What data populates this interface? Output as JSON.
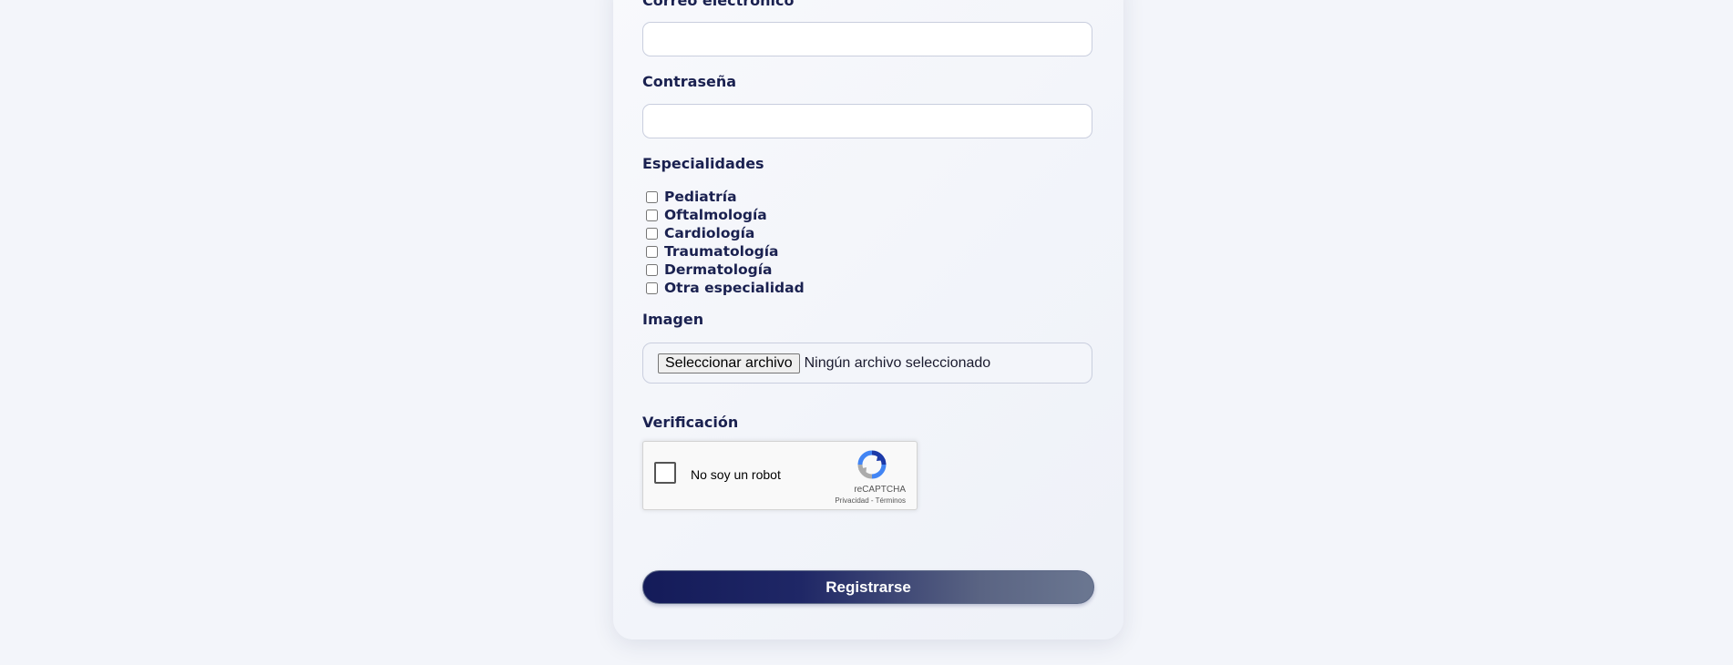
{
  "form": {
    "email_label": "Correo electrónico",
    "email_value": "",
    "password_label": "Contraseña",
    "password_value": "",
    "specialties_label": "Especialidades",
    "specialties": [
      {
        "label": "Pediatría",
        "checked": false
      },
      {
        "label": "Oftalmología",
        "checked": false
      },
      {
        "label": "Cardiología",
        "checked": false
      },
      {
        "label": "Traumatología",
        "checked": false
      },
      {
        "label": "Dermatología",
        "checked": false
      },
      {
        "label": "Otra especialidad",
        "checked": false
      }
    ],
    "image_label": "Imagen",
    "file_button_label": "Seleccionar archivo",
    "file_status": "Ningún archivo seleccionado",
    "verification_label": "Verificación",
    "captcha": {
      "text": "No soy un robot",
      "brand": "reCAPTCHA",
      "links": "Privacidad - Términos"
    },
    "submit_label": "Registrarse"
  },
  "colors": {
    "label_text": "#1a2150",
    "button_gradient_start": "#141b59",
    "button_gradient_end": "#6b7791",
    "page_background": "#f3f5fa"
  },
  "icons": {
    "captcha_logo": "recaptcha-logo-icon"
  }
}
